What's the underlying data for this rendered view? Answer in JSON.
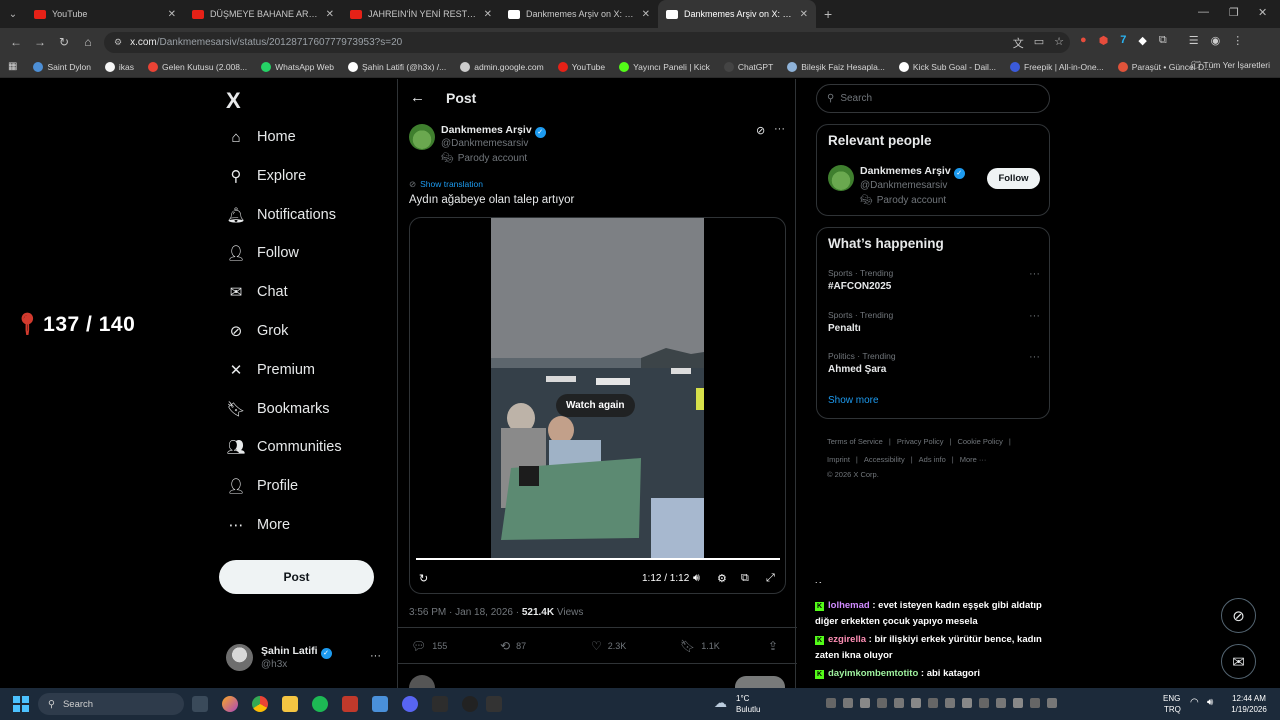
{
  "browser": {
    "tabs": [
      {
        "title": "YouTube",
        "icon_color": "#e62117",
        "active": false
      },
      {
        "title": "DÜŞMEYE BAHANE ARAMAK |",
        "icon_color": "#e62117",
        "active": false
      },
      {
        "title": "JAHREIN'İN YENİ RESTORANIN",
        "icon_color": "#e62117",
        "active": false
      },
      {
        "title": "Dankmemes Arşiv on X: \"TunAr",
        "icon_color": "#ffffff",
        "active": false
      },
      {
        "title": "Dankmemes Arşiv on X: \"Aydın",
        "icon_color": "#ffffff",
        "active": true
      }
    ],
    "new_tab": "+",
    "url_host": "x.com",
    "url_path": "/Dankmemesarsiv/status/2012871760777973953?s=20",
    "bookmarks": [
      {
        "label": "Saint Dylon",
        "color": "#4d8fd6"
      },
      {
        "label": "ikas",
        "color": "#f5f5f5"
      },
      {
        "label": "Gelen Kutusu (2.008...",
        "color": "#ea4335"
      },
      {
        "label": "WhatsApp Web",
        "color": "#25d366"
      },
      {
        "label": "Şahin Latifi (@h3x) /...",
        "color": "#ffffff"
      },
      {
        "label": "admin.google.com",
        "color": "#cccccc"
      },
      {
        "label": "YouTube",
        "color": "#e62117"
      },
      {
        "label": "Yayıncı Paneli | Kick",
        "color": "#53fc18"
      },
      {
        "label": "ChatGPT",
        "color": "#444444"
      },
      {
        "label": "Bileşik Faiz Hesapla...",
        "color": "#8fb3d9"
      },
      {
        "label": "Kick Sub Goal - Dail...",
        "color": "#ffffff"
      },
      {
        "label": "Freepik | All-in-One...",
        "color": "#3b5bdb"
      },
      {
        "label": "Paraşüt • Güncel D...",
        "color": "#e0533a"
      }
    ],
    "bookmarks_all": "Tüm Yer İşaretleri"
  },
  "overlay": {
    "counter": "137 / 140"
  },
  "sidebar": {
    "logo": "X",
    "items": [
      {
        "label": "Home",
        "icon": "home-icon",
        "glyph": "⌂"
      },
      {
        "label": "Explore",
        "icon": "search-icon",
        "glyph": "⚲"
      },
      {
        "label": "Notifications",
        "icon": "bell-icon",
        "glyph": "🔔︎"
      },
      {
        "label": "Follow",
        "icon": "add-person-icon",
        "glyph": "👤︎"
      },
      {
        "label": "Chat",
        "icon": "mail-icon",
        "glyph": "✉"
      },
      {
        "label": "Grok",
        "icon": "grok-icon",
        "glyph": "⊘"
      },
      {
        "label": "Premium",
        "icon": "x-icon",
        "glyph": "✕"
      },
      {
        "label": "Bookmarks",
        "icon": "bookmark-icon",
        "glyph": "🔖︎"
      },
      {
        "label": "Communities",
        "icon": "people-icon",
        "glyph": "👥︎"
      },
      {
        "label": "Profile",
        "icon": "person-icon",
        "glyph": "👤︎"
      },
      {
        "label": "More",
        "icon": "more-circle-icon",
        "glyph": "⋯"
      }
    ],
    "post_button": "Post",
    "account": {
      "name": "Şahin Latifi",
      "handle": "@h3x",
      "more": "···"
    }
  },
  "main": {
    "header_title": "Post",
    "tweet": {
      "author_name": "Dankmemes Arşiv",
      "author_handle": "@Dankmemesarsiv",
      "parody_label": "Parody account",
      "show_translation": "Show translation",
      "text": "Aydın ağabeye olan talep artıyor",
      "video": {
        "watch_again": "Watch again",
        "time": "1:12 / 1:12",
        "progress": 1.0
      },
      "timestamp": "3:56 PM · Jan 18, 2026 · ",
      "views_count": "521.4K",
      "views_label": " Views",
      "stats": {
        "replies": "155",
        "reposts": "87",
        "likes": "2.3K",
        "bookmarks": "1.1K"
      }
    }
  },
  "right": {
    "search_placeholder": "Search",
    "relevant_people": {
      "title": "Relevant people",
      "name": "Dankmemes Arşiv",
      "handle": "@Dankmemesarsiv",
      "parody_label": "Parody account",
      "follow_label": "Follow"
    },
    "whats_happening": {
      "title": "What’s happening",
      "trends": [
        {
          "category": "Sports · Trending",
          "name": "#AFCON2025"
        },
        {
          "category": "Sports · Trending",
          "name": "Penaltı"
        },
        {
          "category": "Politics · Trending",
          "name": "Ahmed Şara"
        }
      ],
      "show_more": "Show more"
    },
    "footer": {
      "row1": [
        "Terms of Service",
        "Privacy Policy",
        "Cookie Policy"
      ],
      "row2": [
        "Imprint",
        "Accessibility",
        "Ads info",
        "More ···"
      ],
      "copyright": "© 2026 X Corp."
    }
  },
  "chat": [
    {
      "user": "lolhemad",
      "color": "#d08bff",
      "msg": "evet isteyen kadın eşşek gibi aldatıp diğer erkekten çocuk yapıyo mesela"
    },
    {
      "user": "ezgirella",
      "color": "#ff8fb5",
      "msg": "bir ilişkiyi erkek yürütür bence, kadın zaten ikna oluyor"
    },
    {
      "user": "dayimkombemtotito",
      "color": "#9ff29f",
      "msg": "abi katagori"
    }
  ],
  "taskbar": {
    "search": "Search",
    "weather_temp": "1°C",
    "weather_desc": "Bulutlu",
    "lang_top": "ENG",
    "lang_bottom": "TRQ",
    "time": "12:44 AM",
    "date": "1/19/2026"
  }
}
